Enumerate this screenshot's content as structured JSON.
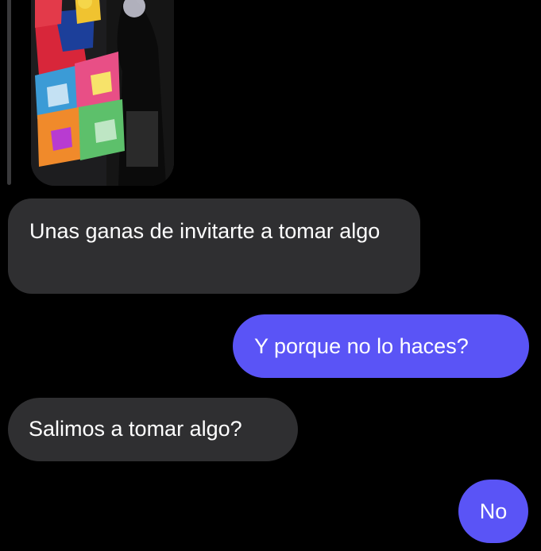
{
  "conversation": {
    "shared_image": {
      "description_icon": "photo-attachment"
    },
    "messages": [
      {
        "sender": "them",
        "text": "Unas ganas de invitarte a tomar algo"
      },
      {
        "sender": "me",
        "text": "Y porque no lo haces?"
      },
      {
        "sender": "them",
        "text": "Salimos a tomar algo?"
      },
      {
        "sender": "me",
        "text": "No"
      }
    ]
  },
  "colors": {
    "background": "#000000",
    "incoming_bubble": "#2f2f31",
    "outgoing_bubble": "#5a54f6",
    "text": "#ffffff"
  }
}
